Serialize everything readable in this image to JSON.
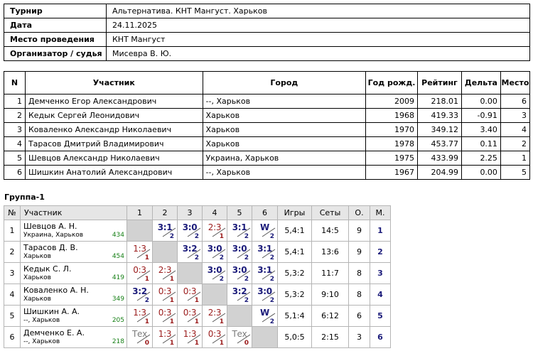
{
  "info": {
    "rows": [
      {
        "key": "Турнир",
        "value": "Альтернатива. КНТ Мангуст. Харьков"
      },
      {
        "key": "Дата",
        "value": "24.11.2025"
      },
      {
        "key": "Место проведения",
        "value": "КНТ Мангуст"
      },
      {
        "key": "Организатор / судья",
        "value": "Мисевра В. Ю."
      }
    ]
  },
  "participants": {
    "headers": [
      "N",
      "Участник",
      "Город",
      "Год рожд.",
      "Рейтинг",
      "Дельта",
      "Место"
    ],
    "rows": [
      {
        "n": "1",
        "name": "Демченко Егор Александрович",
        "city": "--, Харьков",
        "year": "2009",
        "rating": "218.01",
        "delta": "0.00",
        "place": "6"
      },
      {
        "n": "2",
        "name": "Кедык Сергей Леонидович",
        "city": "Харьков",
        "year": "1968",
        "rating": "419.33",
        "delta": "-0.91",
        "place": "3"
      },
      {
        "n": "3",
        "name": "Коваленко Александр Николаевич",
        "city": "Харьков",
        "year": "1970",
        "rating": "349.12",
        "delta": "3.40",
        "place": "4"
      },
      {
        "n": "4",
        "name": "Тарасов Дмитрий Владимирович",
        "city": "Харьков",
        "year": "1978",
        "rating": "453.77",
        "delta": "0.11",
        "place": "2"
      },
      {
        "n": "5",
        "name": "Шевцов Александр Николаевич",
        "city": "Украина, Харьков",
        "year": "1975",
        "rating": "433.99",
        "delta": "2.25",
        "place": "1"
      },
      {
        "n": "6",
        "name": "Шишкин Анатолий Александрович",
        "city": "--, Харьков",
        "year": "1967",
        "rating": "204.99",
        "delta": "0.00",
        "place": "5"
      }
    ]
  },
  "group": {
    "title": "Группа-1",
    "headers": {
      "num": "№",
      "player": "Участник",
      "cols": [
        "1",
        "2",
        "3",
        "4",
        "5",
        "6"
      ],
      "games": "Игры",
      "sets": "Сеты",
      "points": "О.",
      "place": "М."
    },
    "rows": [
      {
        "num": "1",
        "name": "Шевцов А. Н.",
        "city": "Украина, Харьков",
        "rating": "434",
        "results": [
          {
            "type": "self",
            "score": "",
            "pts": ""
          },
          {
            "type": "win",
            "score": "3:1",
            "pts": "2"
          },
          {
            "type": "win",
            "score": "3:0",
            "pts": "2"
          },
          {
            "type": "loss",
            "score": "2:3",
            "pts": "1"
          },
          {
            "type": "win",
            "score": "3:1",
            "pts": "2"
          },
          {
            "type": "win",
            "score": "W",
            "pts": "2"
          }
        ],
        "games": "5,4:1",
        "sets": "14:5",
        "points": "9",
        "place": "1"
      },
      {
        "num": "2",
        "name": "Тарасов Д. В.",
        "city": "Харьков",
        "rating": "454",
        "results": [
          {
            "type": "loss",
            "score": "1:3",
            "pts": "1"
          },
          {
            "type": "self",
            "score": "",
            "pts": ""
          },
          {
            "type": "win",
            "score": "3:2",
            "pts": "2"
          },
          {
            "type": "win",
            "score": "3:0",
            "pts": "2"
          },
          {
            "type": "win",
            "score": "3:0",
            "pts": "2"
          },
          {
            "type": "win",
            "score": "3:1",
            "pts": "2"
          }
        ],
        "games": "5,4:1",
        "sets": "13:6",
        "points": "9",
        "place": "2"
      },
      {
        "num": "3",
        "name": "Кедык С. Л.",
        "city": "Харьков",
        "rating": "419",
        "results": [
          {
            "type": "loss",
            "score": "0:3",
            "pts": "1"
          },
          {
            "type": "loss",
            "score": "2:3",
            "pts": "1"
          },
          {
            "type": "self",
            "score": "",
            "pts": ""
          },
          {
            "type": "win",
            "score": "3:0",
            "pts": "2"
          },
          {
            "type": "win",
            "score": "3:0",
            "pts": "2"
          },
          {
            "type": "win",
            "score": "3:1",
            "pts": "2"
          }
        ],
        "games": "5,3:2",
        "sets": "11:7",
        "points": "8",
        "place": "3"
      },
      {
        "num": "4",
        "name": "Коваленко А. Н.",
        "city": "Харьков",
        "rating": "349",
        "results": [
          {
            "type": "win",
            "score": "3:2",
            "pts": "2"
          },
          {
            "type": "loss",
            "score": "0:3",
            "pts": "1"
          },
          {
            "type": "loss",
            "score": "0:3",
            "pts": "1"
          },
          {
            "type": "self",
            "score": "",
            "pts": ""
          },
          {
            "type": "win",
            "score": "3:2",
            "pts": "2"
          },
          {
            "type": "win",
            "score": "3:0",
            "pts": "2"
          }
        ],
        "games": "5,3:2",
        "sets": "9:10",
        "points": "8",
        "place": "4"
      },
      {
        "num": "5",
        "name": "Шишкин А. А.",
        "city": "--, Харьков",
        "rating": "205",
        "results": [
          {
            "type": "loss",
            "score": "1:3",
            "pts": "1"
          },
          {
            "type": "loss",
            "score": "0:3",
            "pts": "1"
          },
          {
            "type": "loss",
            "score": "0:3",
            "pts": "1"
          },
          {
            "type": "loss",
            "score": "2:3",
            "pts": "1"
          },
          {
            "type": "self",
            "score": "",
            "pts": ""
          },
          {
            "type": "win",
            "score": "W",
            "pts": "2"
          }
        ],
        "games": "5,1:4",
        "sets": "6:12",
        "points": "6",
        "place": "5"
      },
      {
        "num": "6",
        "name": "Демченко Е. А.",
        "city": "--, Харьков",
        "rating": "218",
        "results": [
          {
            "type": "tech",
            "score": "Тех",
            "pts": "0"
          },
          {
            "type": "loss",
            "score": "1:3",
            "pts": "1"
          },
          {
            "type": "loss",
            "score": "1:3",
            "pts": "1"
          },
          {
            "type": "loss",
            "score": "0:3",
            "pts": "1"
          },
          {
            "type": "tech",
            "score": "Тех",
            "pts": "0"
          },
          {
            "type": "self",
            "score": "",
            "pts": ""
          }
        ],
        "games": "5,0:5",
        "sets": "2:15",
        "points": "3",
        "place": "6"
      }
    ]
  }
}
